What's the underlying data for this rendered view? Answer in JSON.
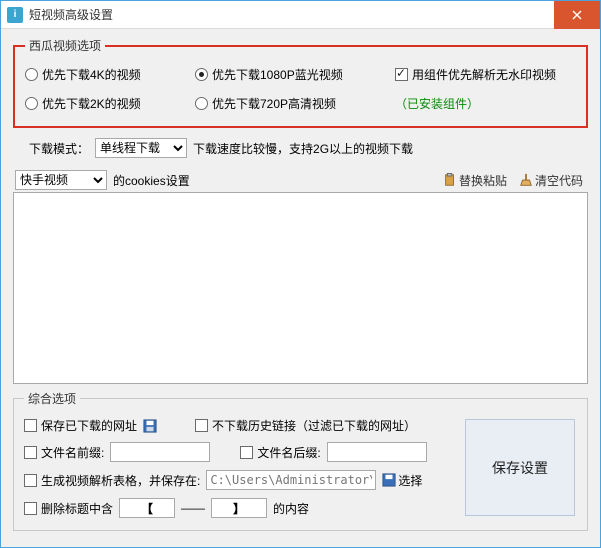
{
  "window": {
    "title": "短视频高级设置"
  },
  "xigua": {
    "legend": "西瓜视频选项",
    "opt_4k": "优先下载4K的视频",
    "opt_1080": "优先下载1080P蓝光视频",
    "opt_nowm": "用组件优先解析无水印视频",
    "opt_2k": "优先下载2K的视频",
    "opt_720": "优先下载720P高清视频",
    "installed": "（已安装组件）"
  },
  "mode": {
    "label": "下载模式：",
    "value": "单线程下载",
    "hint": "下载速度比较慢，支持2G以上的视频下载"
  },
  "cookies": {
    "source_value": "快手视频",
    "label": "的cookies设置",
    "paste": "替换粘贴",
    "clear": "清空代码"
  },
  "general": {
    "legend": "综合选项",
    "save_urls": "保存已下载的网址",
    "skip_history": "不下载历史链接（过滤已下载的网址）",
    "prefix": "文件名前缀:",
    "suffix": "文件名后缀:",
    "gen_table": "生成视频解析表格，并保存在:",
    "path_value": "C:\\Users\\Administrator\\De",
    "select": "选择",
    "remove_title": "删除标题中含",
    "bracket_open": "【",
    "dash": "——",
    "bracket_close": "】",
    "content": "的内容"
  },
  "save": {
    "label": "保存设置"
  }
}
